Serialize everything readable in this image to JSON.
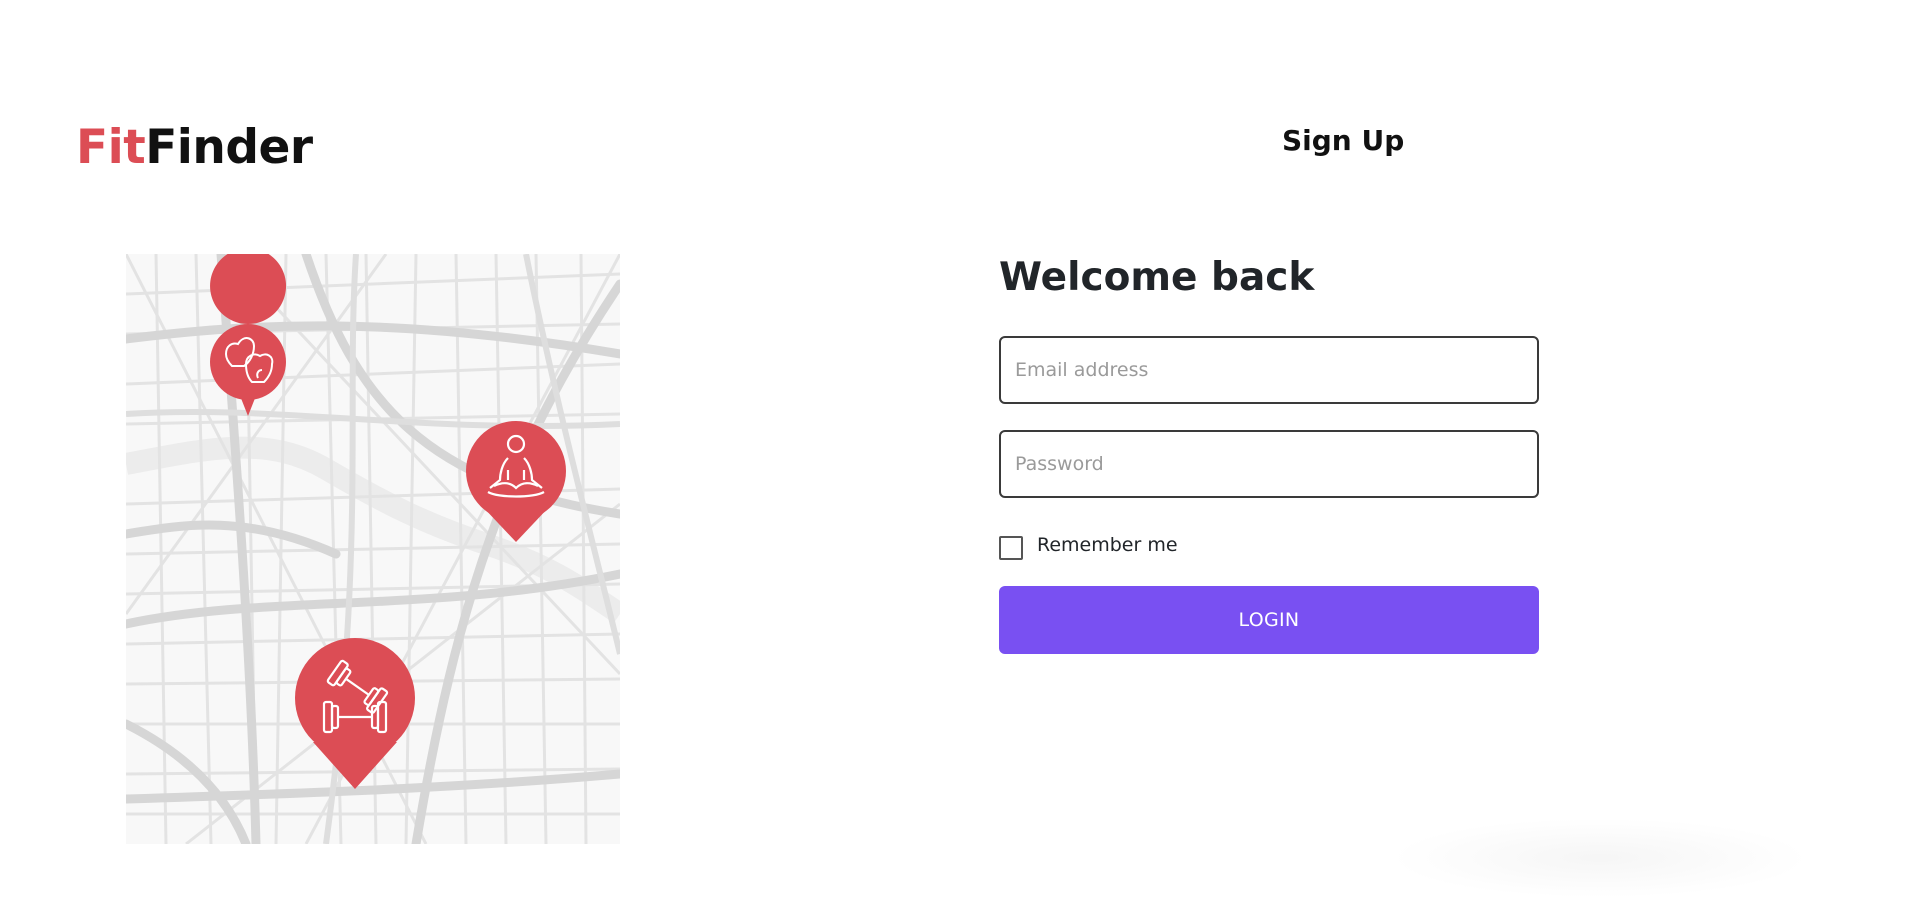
{
  "brand": {
    "prefix": "Fit",
    "suffix": "Finder",
    "prefix_color": "#dc4d55"
  },
  "nav": {
    "signup_label": "Sign Up"
  },
  "illustration": {
    "pins": [
      {
        "icon": "boxing-gloves-icon"
      },
      {
        "icon": "yoga-meditation-icon"
      },
      {
        "icon": "dumbbells-icon"
      }
    ],
    "pin_color": "#dc4d55"
  },
  "login": {
    "heading": "Welcome back",
    "email_placeholder": "Email address",
    "email_value": "",
    "password_placeholder": "Password",
    "password_value": "",
    "remember_label": "Remember me",
    "remember_checked": false,
    "button_label": "LOGIN",
    "button_color": "#7950f2"
  }
}
